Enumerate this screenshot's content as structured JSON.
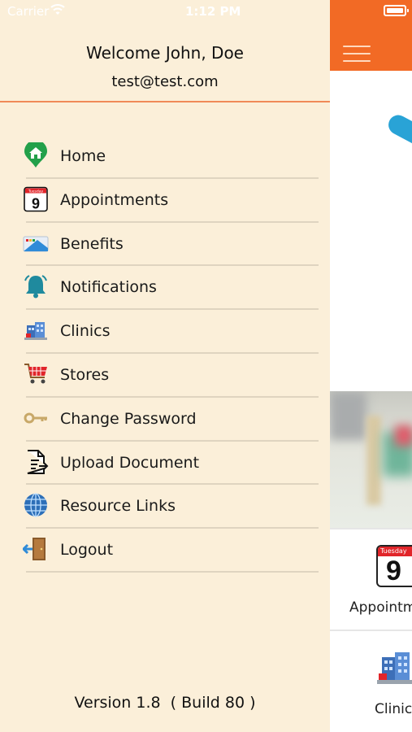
{
  "status_bar": {
    "carrier": "Carrier",
    "time": "1:12 PM"
  },
  "drawer": {
    "welcome": "Welcome John, Doe",
    "email": "test@test.com",
    "items": [
      {
        "label": "Home",
        "icon": "home-icon"
      },
      {
        "label": "Appointments",
        "icon": "calendar-icon",
        "calendar_day": "9",
        "calendar_weekday": "Tuesday"
      },
      {
        "label": "Benefits",
        "icon": "benefits-card-icon"
      },
      {
        "label": "Notifications",
        "icon": "bell-icon"
      },
      {
        "label": "Clinics",
        "icon": "clinic-building-icon"
      },
      {
        "label": "Stores",
        "icon": "shopping-cart-icon"
      },
      {
        "label": "Change Password",
        "icon": "key-icon"
      },
      {
        "label": "Upload Document",
        "icon": "upload-document-icon"
      },
      {
        "label": "Resource Links",
        "icon": "globe-icon"
      },
      {
        "label": "Logout",
        "icon": "logout-door-icon"
      }
    ],
    "version": "Version 1.8  ( Build 80 )"
  },
  "main": {
    "tiles": [
      {
        "label": "Appointm",
        "calendar_weekday": "Tuesday",
        "calendar_day": "9"
      },
      {
        "label": "Clinic"
      }
    ]
  },
  "colors": {
    "drawer_bg": "#fbefd9",
    "navbar": "#f26a25",
    "header_divider": "#f08a58"
  }
}
